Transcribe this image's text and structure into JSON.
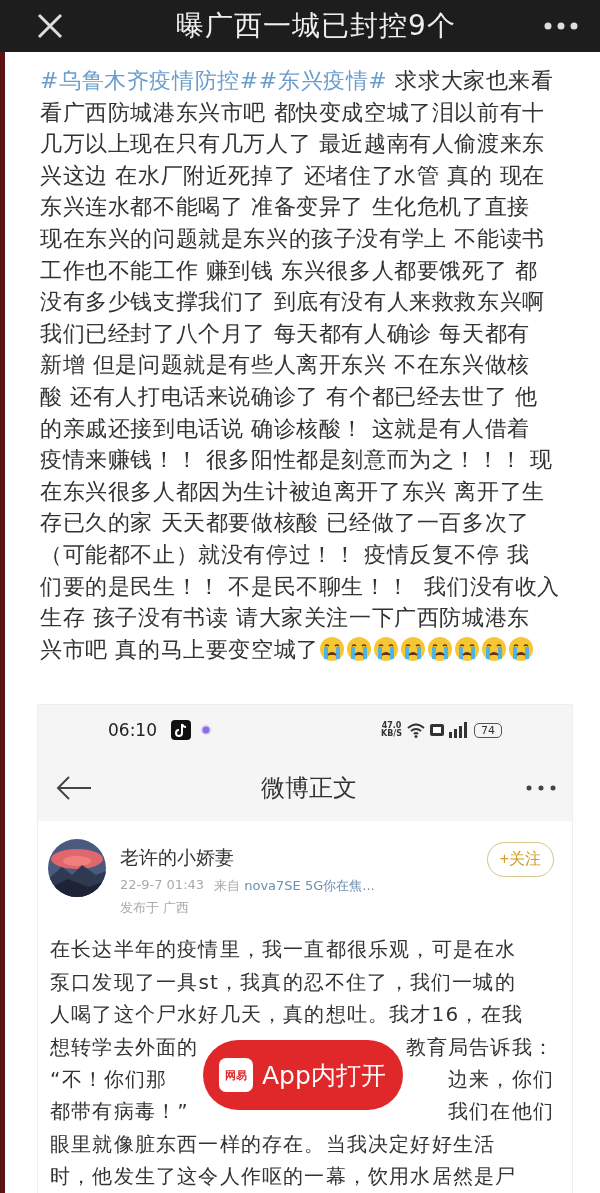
{
  "top_bar": {
    "title": "曝广西一城已封控9个"
  },
  "post": {
    "lines": [
      {
        "hashtag": "#乌鲁木齐疫情防控##东兴疫情#",
        "text": "求求大家也来看"
      },
      {
        "text": "看广西防城港东兴市吧 都快变成空城了泪以前有十"
      },
      {
        "text": "几万以上现在只有几万人了 最近越南有人偷渡来东"
      },
      {
        "text": "兴这边 在水厂附近死掉了 还堵住了水管 真的 现在"
      },
      {
        "text": "东兴连水都不能喝了 准备变异了 生化危机了直接"
      },
      {
        "text": "现在东兴的问题就是东兴的孩子没有学上 不能读书"
      },
      {
        "text": "工作也不能工作 赚到钱 东兴很多人都要饿死了 都"
      },
      {
        "text": "没有多少钱支撑我们了 到底有没有人来救救东兴啊"
      },
      {
        "text": "我们已经封了八个月了 每天都有人确诊 每天都有"
      },
      {
        "text": "新增 但是问题就是有些人离开东兴 不在东兴做核"
      },
      {
        "text": "酸 还有人打电话来说确诊了 有个都已经去世了 他"
      },
      {
        "text": "的亲戚还接到电话说 确诊核酸！ 这就是有人借着"
      },
      {
        "text": "疫情来赚钱！！ 很多阳性都是刻意而为之！！！ 现"
      },
      {
        "text": "在东兴很多人都因为生计被迫离开了东兴 离开了生"
      },
      {
        "text": "存已久的家 天天都要做核酸 已经做了一百多次了"
      },
      {
        "text": "（可能都不止）就没有停过！！ 疫情反复不停 我"
      },
      {
        "text": "们要的是民生！！ 不是民不聊生！！  我们没有收入"
      },
      {
        "text": "生存 孩子没有书读 请大家关注一下广西防城港东"
      },
      {
        "text": "兴市吧 真的马上要变空城了"
      }
    ],
    "emojis": [
      {
        "kind": "crying"
      },
      {
        "kind": "crying"
      },
      {
        "kind": "crying"
      },
      {
        "kind": "crying"
      },
      {
        "kind": "crying"
      },
      {
        "kind": "crying"
      },
      {
        "kind": "crying"
      },
      {
        "kind": "crying"
      }
    ]
  },
  "embedded_screenshot": {
    "status_bar": {
      "time": "06:10",
      "net_speed": "47.0",
      "net_unit": "KB/S",
      "battery": "74"
    },
    "nav": {
      "title": "微博正文"
    },
    "author": {
      "name": "老许的小娇妻",
      "follow": "+关注",
      "date": "22-9-7 01:43",
      "source_label": "来自",
      "source": "nova7SE 5G你在焦...",
      "location": "发布于 广西"
    },
    "body_lines": [
      {
        "parts": [
          "在长达半年的疫情里，我一直都很乐观，可是在水"
        ]
      },
      {
        "parts": [
          "泵口发现了一具st，我真的忍不住了，我们一城的"
        ]
      },
      {
        "parts": [
          "人喝了这个尸水好几天，真的想吐。我才16，在我"
        ]
      },
      {
        "parts": [
          "想转学去外面的",
          "教育局告诉我："
        ]
      },
      {
        "parts": [
          "“不！你们那",
          "边来，你们"
        ]
      },
      {
        "parts": [
          "都带有病毒！”",
          "我们在他们"
        ]
      },
      {
        "parts": [
          "眼里就像脏东西一样的存在。当我决定好好生活"
        ]
      },
      {
        "parts": [
          "时，他发生了这令人作呕的一幕，饮用水居然是尸"
        ]
      }
    ]
  },
  "open_in_app": {
    "logo_text": "网易",
    "label": "App内打开"
  }
}
